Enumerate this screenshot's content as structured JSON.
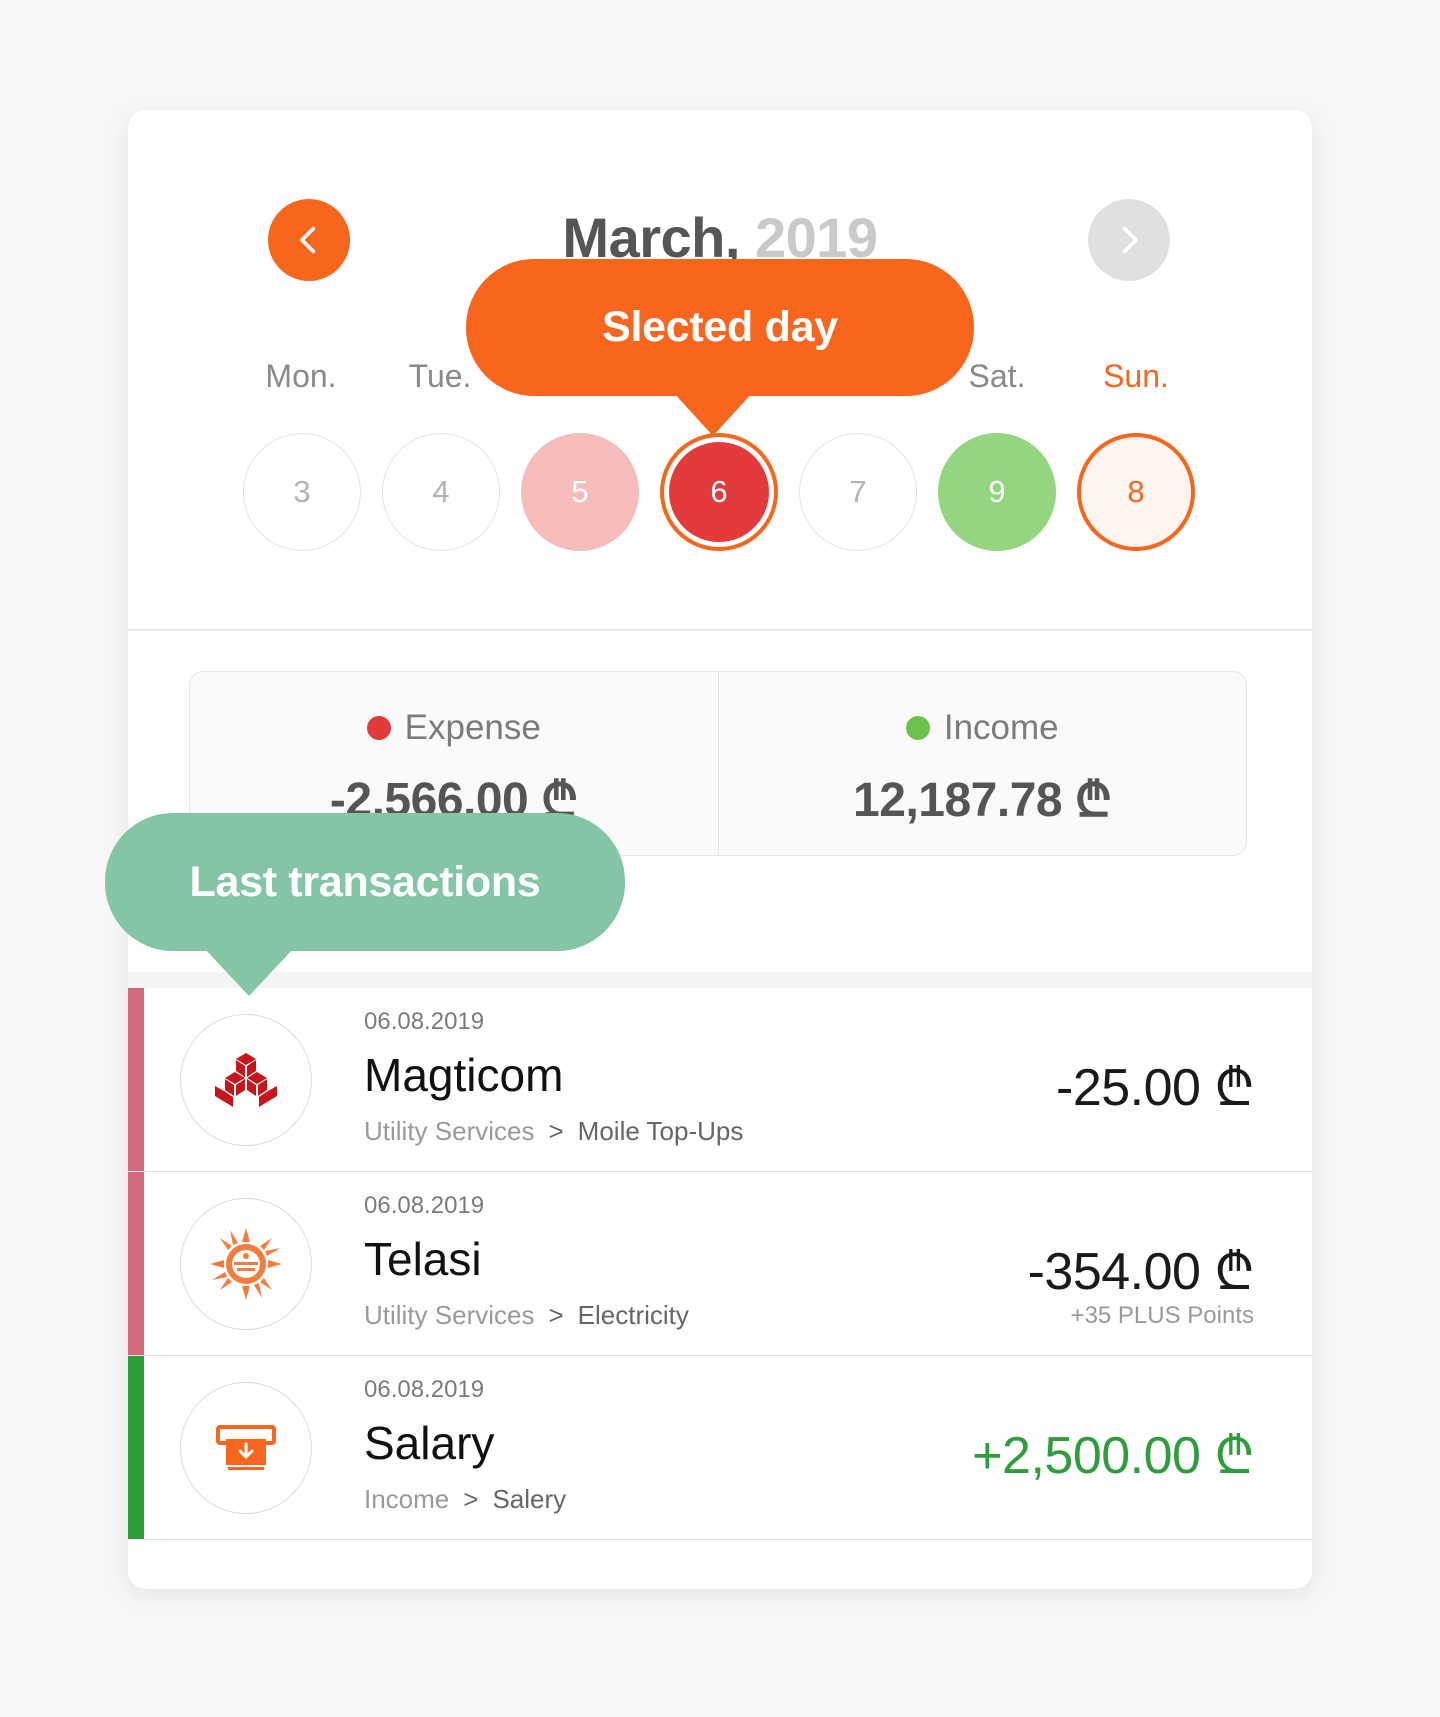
{
  "calendar": {
    "month": "March,",
    "year": "2019",
    "weekdays": [
      "Mon.",
      "Tue.",
      "Sat.",
      "Sun."
    ],
    "days": [
      "3",
      "4",
      "5",
      "6",
      "7",
      "9",
      "8"
    ]
  },
  "summary": {
    "expense_label": "Expense",
    "expense_value": "-2,566.00 ₾",
    "income_label": "Income",
    "income_value": "12,187.78 ₾"
  },
  "transactions": [
    {
      "date": "06.08.2019",
      "name": "Magticom",
      "category": "Utility Services",
      "separator": ">",
      "subcategory": "Moile Top-Ups",
      "amount": "-25.00 ₾",
      "icon": "magticom-logo-icon"
    },
    {
      "date": "06.08.2019",
      "name": "Telasi",
      "category": "Utility Services",
      "separator": ">",
      "subcategory": "Electricity",
      "amount": "-354.00 ₾",
      "points": "+35 PLUS Points",
      "icon": "telasi-logo-icon"
    },
    {
      "date": "06.08.2019",
      "name": "Salary",
      "category": "Income",
      "separator": ">",
      "subcategory": "Salery",
      "amount": "+2,500.00 ₾",
      "icon": "atm-cash-icon"
    }
  ],
  "callouts": {
    "selected_day": "Slected day",
    "last_transactions": "Last transactions"
  },
  "colors": {
    "accent": "#f8661d",
    "expense": "#e33a3c",
    "income": "#6cc24a",
    "expense_bar": "#d4687c",
    "income_bar": "#2e9e3a",
    "callout_green": "#84c5a5"
  }
}
